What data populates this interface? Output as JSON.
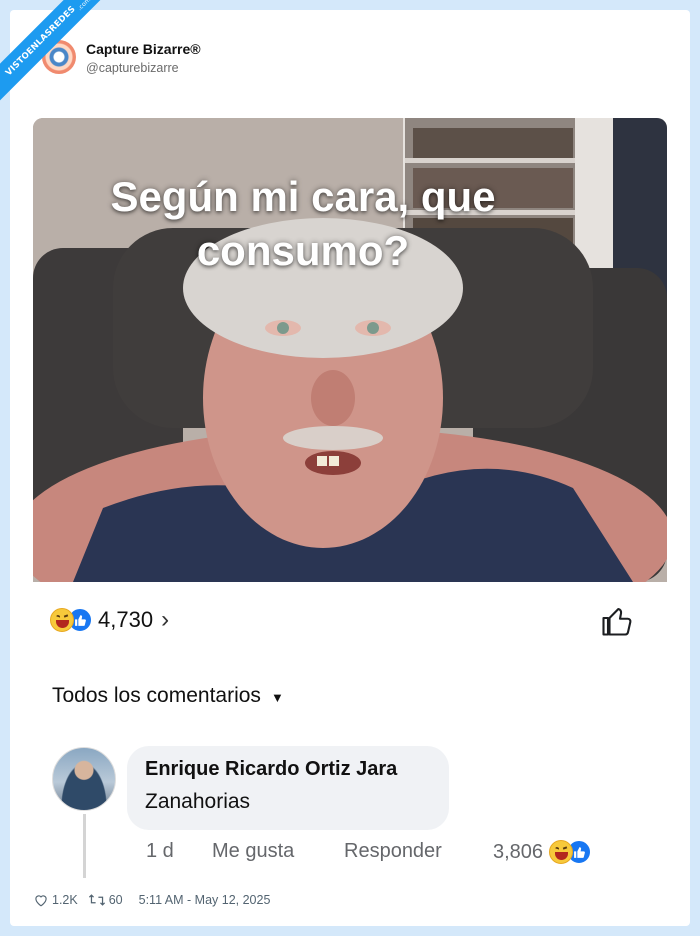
{
  "watermark": {
    "main": "VISTOENLASREDES",
    "sub": ".com"
  },
  "account": {
    "name": "Capture Bizarre®",
    "handle": "@capturebizarre"
  },
  "post": {
    "caption": "Según mi cara, que consumo?",
    "reactions": {
      "count": "4,730",
      "icons": [
        "haha-emoji-icon",
        "like-emoji-icon"
      ]
    },
    "all_comments_label": "Todos los comentarios",
    "comment": {
      "author": "Enrique Ricardo Ortiz Jara",
      "text": "Zanahorias",
      "time": "1 d",
      "like_label": "Me gusta",
      "reply_label": "Responder",
      "reaction_count": "3,806"
    }
  },
  "footer": {
    "likes": "1.2K",
    "retweets": "60",
    "timestamp": "5:11 AM - May 12, 2025"
  },
  "colors": {
    "background": "#d4e8fa",
    "accent": "#1d9bf0",
    "fb_blue": "#1877f2",
    "haha": "#f7c93b"
  }
}
